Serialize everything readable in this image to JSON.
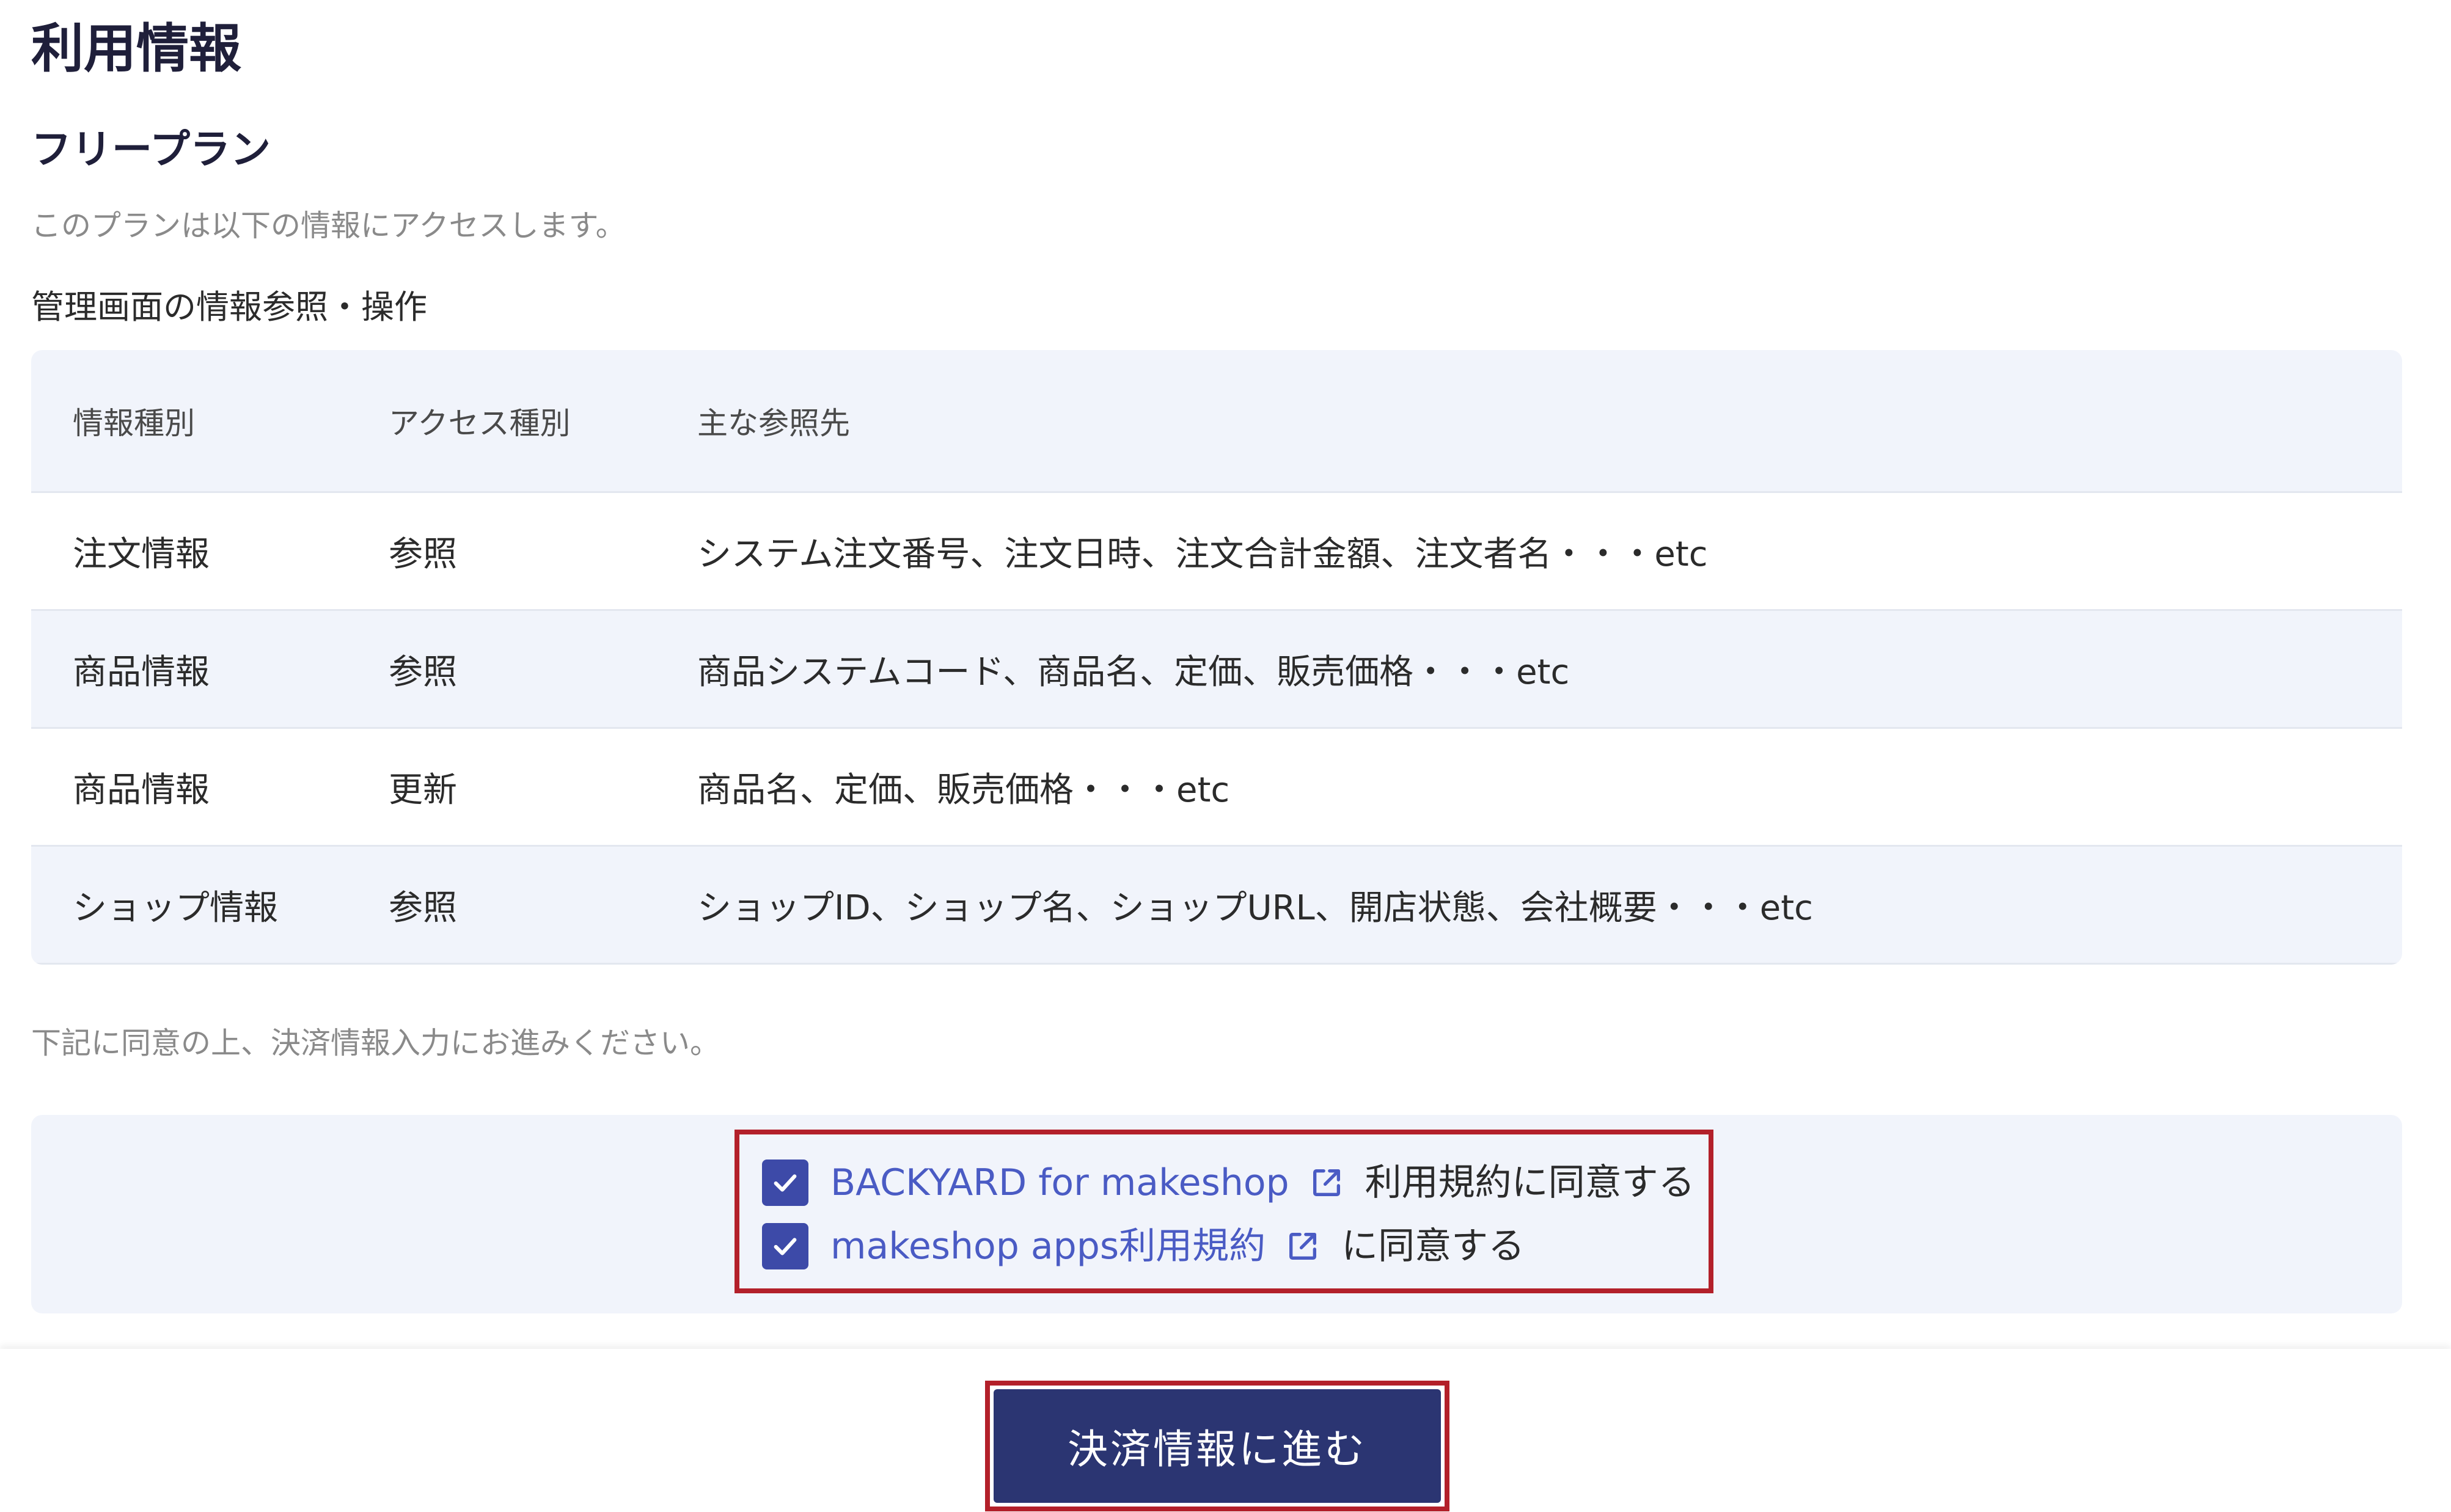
{
  "page": {
    "title": "利用情報"
  },
  "plan": {
    "name": "フリープラン",
    "description": "このプランは以下の情報にアクセスします。"
  },
  "access_section": {
    "title": "管理画面の情報参照・操作",
    "headers": [
      "情報種別",
      "アクセス種別",
      "主な参照先"
    ],
    "rows": [
      {
        "info_type": "注文情報",
        "access_type": "参照",
        "main_refs": "システム注文番号、注文日時、注文合計金額、注文者名・・・etc"
      },
      {
        "info_type": "商品情報",
        "access_type": "参照",
        "main_refs": "商品システムコード、商品名、定価、販売価格・・・etc"
      },
      {
        "info_type": "商品情報",
        "access_type": "更新",
        "main_refs": "商品名、定価、販売価格・・・etc"
      },
      {
        "info_type": "ショップ情報",
        "access_type": "参照",
        "main_refs": "ショップID、ショップ名、ショップURL、開店状態、会社概要・・・etc"
      }
    ]
  },
  "agreement": {
    "note": "下記に同意の上、決済情報入力にお進みください。",
    "items": [
      {
        "link_text": "BACKYARD for makeshop",
        "suffix": "利用規約に同意する",
        "checked": true
      },
      {
        "link_text": "makeshop apps利用規約",
        "suffix": "に同意する",
        "checked": true
      }
    ]
  },
  "footer": {
    "submit_label": "決済情報に進む"
  },
  "colors": {
    "accent": "#3d4aa8",
    "link": "#4a5bc4",
    "button": "#2b3572",
    "highlight_border": "#b3202a",
    "table_alt_bg": "#f1f4fb"
  },
  "icons": {
    "checkbox": "check-icon",
    "external_link": "external-link-icon"
  }
}
